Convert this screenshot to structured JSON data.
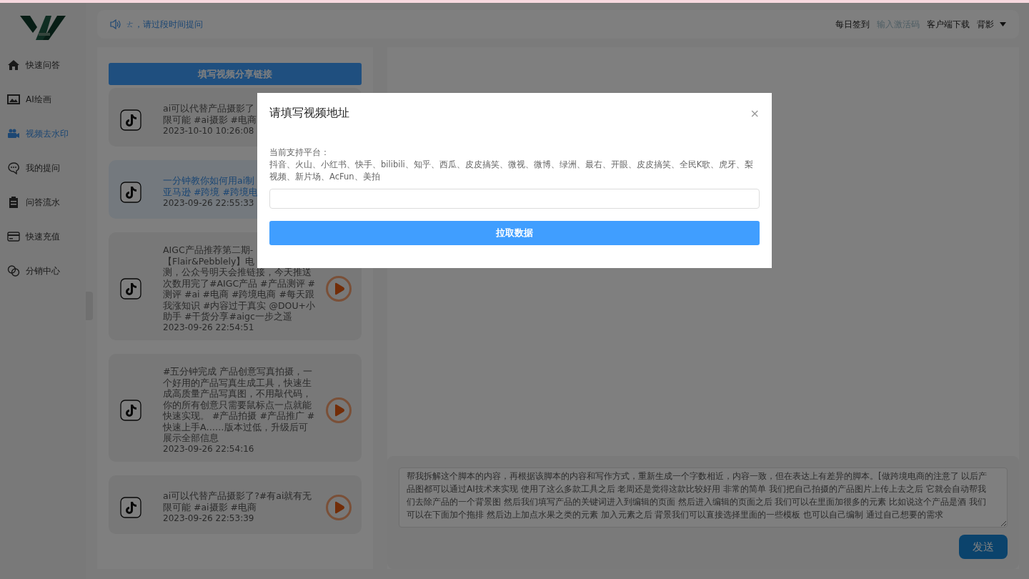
{
  "sidebar": {
    "items": [
      {
        "label": "快速问答",
        "selected": false
      },
      {
        "label": "AI绘画",
        "selected": false
      },
      {
        "label": "视频去水印",
        "selected": true
      },
      {
        "label": "我的提问",
        "selected": false
      },
      {
        "label": "问答流水",
        "selected": false
      },
      {
        "label": "快速充值",
        "selected": false
      },
      {
        "label": "分销中心",
        "selected": false
      }
    ]
  },
  "header": {
    "notice": "ㄊ，请过段时间提问",
    "links": [
      {
        "label": "每日签到",
        "accent": false
      },
      {
        "label": "输入激活码",
        "accent": true
      },
      {
        "label": "客户端下载",
        "accent": false
      }
    ],
    "user": "背影"
  },
  "video_panel": {
    "share_button": "填写视频分享链接",
    "videos": [
      {
        "lines": [
          "ai可以代替产品摄影了",
          "限可能 #ai摄影 #电商"
        ],
        "time": "2023-10-10 10:26:08",
        "selected": false,
        "play_button": false
      },
      {
        "lines": [
          "一分钟教你如何用ai制",
          "亚马逊 #跨境 #跨境电"
        ],
        "time": "2023-09-26 22:55:33",
        "selected": true,
        "play_button": false
      },
      {
        "lines": [
          "AIGC产品推荐第二期-",
          "【Flair&Pebblely】电",
          "测，公众号明天会推链接，今天推送",
          "次数用完了#AIGC产品 #产品测评 #",
          "测评 #ai #电商 #跨境电商 #每天跟",
          "我涨知识 #内容过于真实 @DOU+小",
          "助手 #干货分享#aigc一步之遥"
        ],
        "time": "2023-09-26 22:54:51",
        "selected": false,
        "play_button": true
      },
      {
        "lines": [
          "#五分钟完成 产品创意写真拍摄，一",
          "个好用的产品写真生成工具，快速生",
          "成高质量产品写真图，不用敲代码，",
          "你的所有创意只需要鼠标点一点就能",
          "快速实现。 #产品拍摄 #产品推广 #",
          "快速上手A……版本过低，升级后可",
          "展示全部信息"
        ],
        "time": "2023-09-26 22:54:16",
        "selected": false,
        "play_button": true
      },
      {
        "lines": [
          "ai可以代替产品摄影了?#有ai就有无",
          "限可能 #ai摄影 #电商"
        ],
        "time": "2023-09-26 22:53:39",
        "selected": false,
        "play_button": true
      }
    ]
  },
  "chat": {
    "input": "帮我拆解这个脚本的内容，再根据该脚本的内容和写作方式，重新生成一个字数相近，内容一致，但在表达上有差异的脚本。[做跨境电商的注意了 以后产品图都可以通过AI技术来实现 使用了这么多款工具之后 老周还是觉得这款比较好用 非常的简单 我们把自己拍摄的产品图片上传上去之后 它就会自动帮我们去除产品的一个背景图 然后我们填写产品的关键词进入到编辑的页面 然后进入编辑的页面之后 我们可以在里面加很多的元素 比如说这个产品是酒 我们可以在下面加个拖排 然后边上加点水果之类的元素 加入元素之后 背景我们可以直接选择里面的一些模板 也可以自己编制 通过自己想要的需求",
    "send": "发送"
  },
  "dialog": {
    "title": "请填写视频地址",
    "close": "×",
    "label": "当前支持平台：",
    "platforms": "抖音、火山、小红书、快手、bilibili、知乎、西瓜、皮皮搞笑、微视、微博、绿洲、最右、开眼、皮皮搞笑、全民K歌、虎牙、梨视频、新片场、AcFun、美拍",
    "button": "拉取数据"
  }
}
